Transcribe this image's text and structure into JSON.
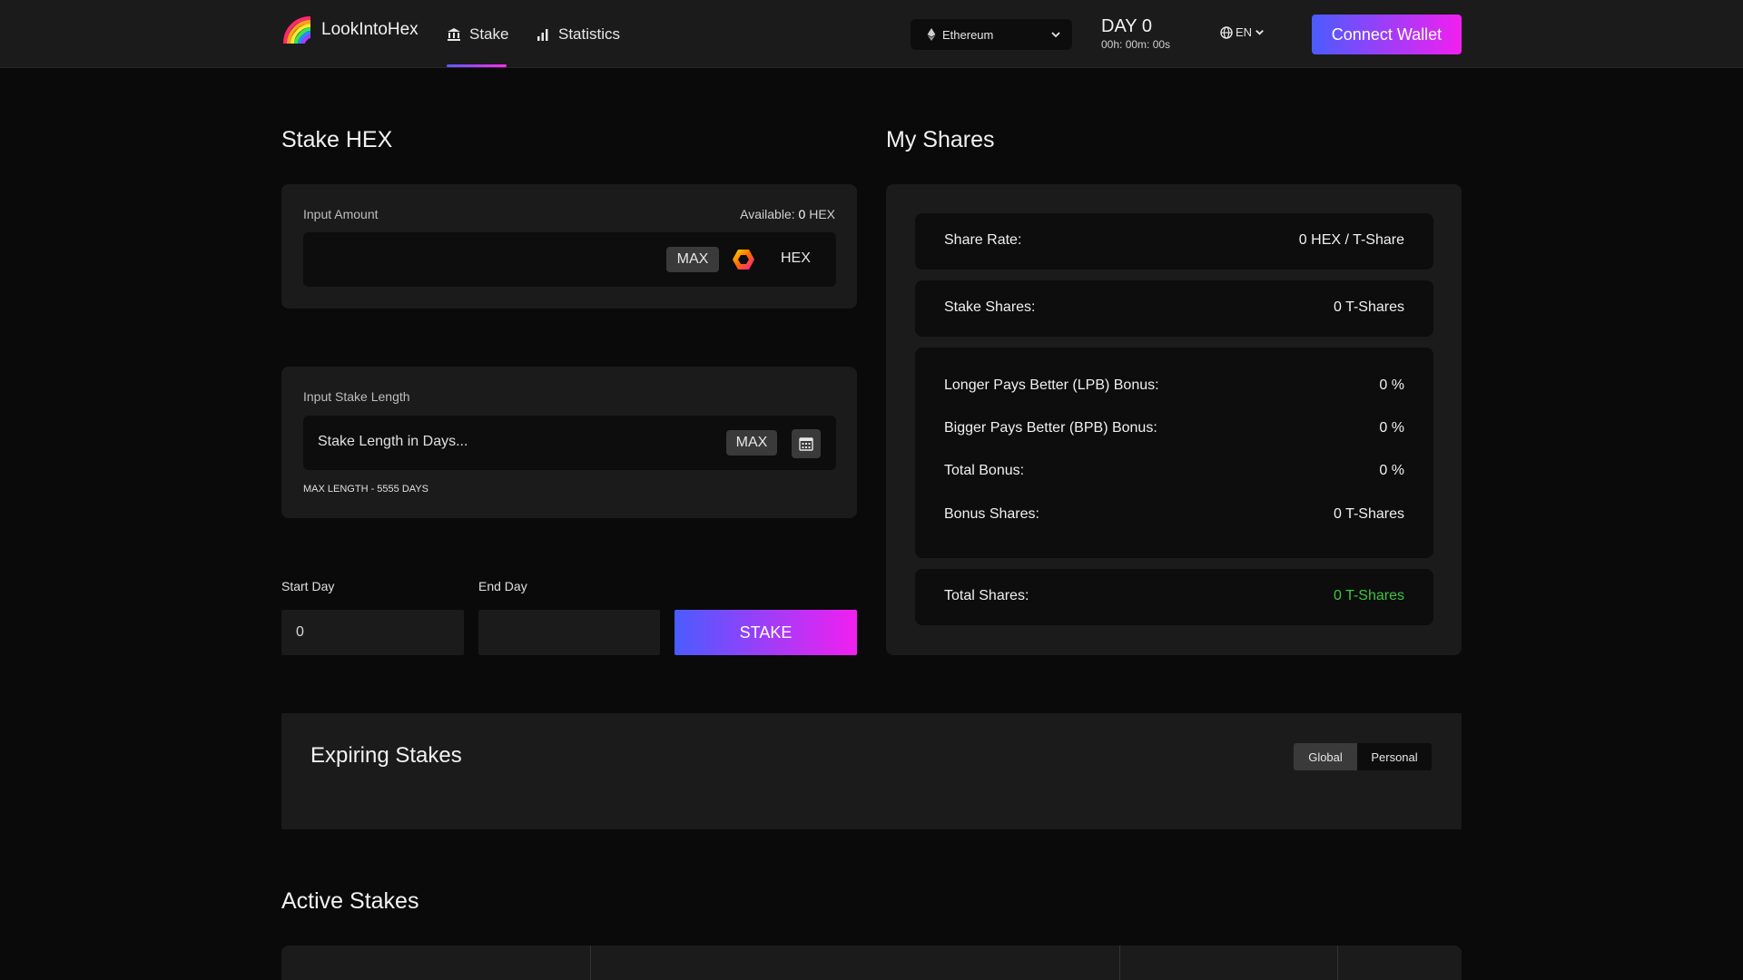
{
  "nav": {
    "brand": "LookIntoHex",
    "links": [
      {
        "label": "Stake",
        "icon": "bank-icon",
        "active": true
      },
      {
        "label": "Statistics",
        "icon": "bar-chart-icon",
        "active": false
      }
    ],
    "network": "Ethereum",
    "day_label": "DAY 0",
    "day_time": "00h: 00m: 00s",
    "language": "EN",
    "connect_label": "Connect Wallet"
  },
  "stake": {
    "title": "Stake HEX",
    "amount_label": "Input Amount",
    "available_prefix": "Available:",
    "available_value": "0",
    "available_unit": "HEX",
    "amount_value": "",
    "max_label": "MAX",
    "token_label": "HEX",
    "length_label": "Input Stake Length",
    "length_placeholder": "Stake Length in Days...",
    "length_max_label": "MAX",
    "max_length_note": "MAX LENGTH - 5555 DAYS",
    "start_day_label": "Start Day",
    "start_day_value": "0",
    "end_day_label": "End Day",
    "end_day_value": "",
    "stake_button": "STAKE"
  },
  "shares": {
    "title": "My Shares",
    "share_rate_label": "Share Rate:",
    "share_rate_value": "0 HEX / T-Share",
    "stake_shares_label": "Stake Shares:",
    "stake_shares_value": "0 T-Shares",
    "lpb_label": "Longer Pays Better (LPB) Bonus:",
    "lpb_value": "0 %",
    "bpb_label": "Bigger Pays Better (BPB) Bonus:",
    "bpb_value": "0 %",
    "total_bonus_label": "Total Bonus:",
    "total_bonus_value": "0 %",
    "bonus_shares_label": "Bonus Shares:",
    "bonus_shares_value": "0 T-Shares",
    "total_shares_label": "Total Shares:",
    "total_shares_value": "0 T-Shares",
    "total_shares_color": "#3fc53f"
  },
  "expiring": {
    "title": "Expiring Stakes",
    "toggle_global": "Global",
    "toggle_personal": "Personal",
    "selected": "Global"
  },
  "active": {
    "title": "Active Stakes"
  },
  "colors": {
    "accent_start": "#4a5cff",
    "accent_end": "#f21ff0",
    "panel": "#1b1b1b",
    "input": "#0d0d0d"
  }
}
